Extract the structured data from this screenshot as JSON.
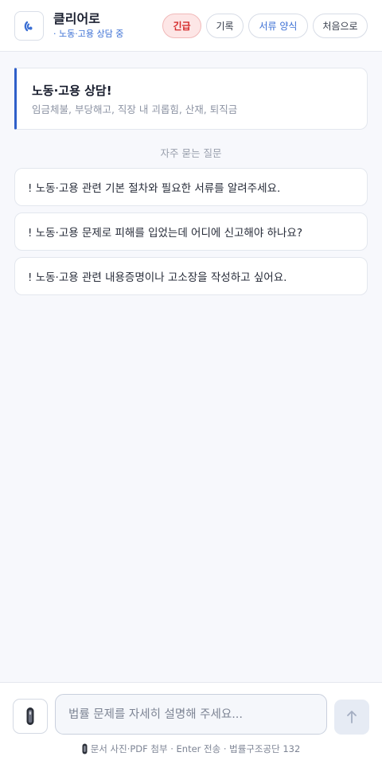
{
  "header": {
    "brand_name": "클리어로",
    "status": "· 노동·고용 상담 중",
    "buttons": {
      "urgent": "긴급",
      "history": "기록",
      "forms": "서류 양식",
      "home": "처음으로"
    },
    "colors": {
      "accent": "#3b6fd4",
      "urgent": "#d52b2b"
    }
  },
  "hero": {
    "title": "노동·고용 상담!",
    "subtitle": "임금체불, 부당해고, 직장 내 괴롭힘, 산재, 퇴직금"
  },
  "faq": {
    "heading": "자주 묻는 질문",
    "items": [
      {
        "label": "! 노동·고용 관련 기본 절차와 필요한 서류를 알려주세요."
      },
      {
        "label": "! 노동·고용 문제로 피해를 입었는데 어디에 신고해야 하나요?"
      },
      {
        "label": "! 노동·고용 관련 내용증명이나 고소장을 작성하고 싶어요."
      }
    ]
  },
  "composer": {
    "attach_icon": "pen-scanner-icon",
    "input_value": "",
    "input_placeholder": "법률 문제를 자세히 설명해 주세요...",
    "send_icon": "arrow-up-icon",
    "footer": "문서 사진·PDF 첨부 · Enter 전송 · 법률구조공단 132"
  }
}
